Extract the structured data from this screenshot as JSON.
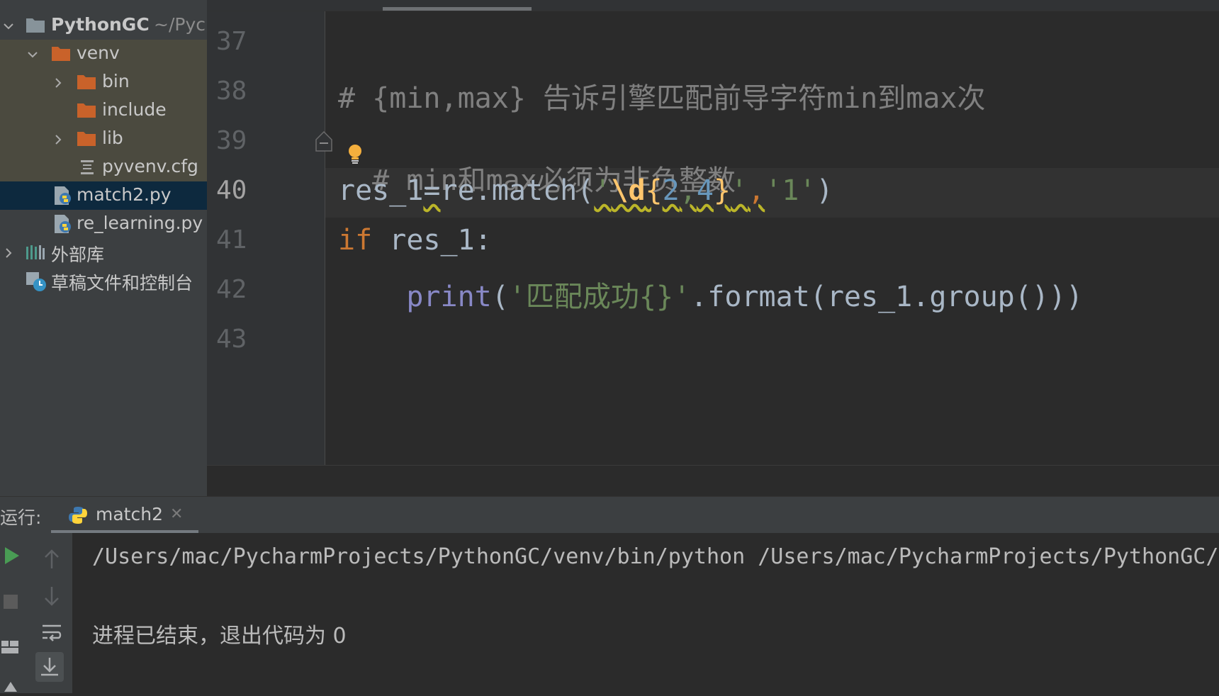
{
  "project": {
    "root_name": "PythonGC",
    "root_path": "~/Pycl",
    "items": [
      {
        "label": "venv",
        "icon": "folder-icon"
      },
      {
        "label": "bin",
        "icon": "folder-icon"
      },
      {
        "label": "include",
        "icon": "folder-icon"
      },
      {
        "label": "lib",
        "icon": "folder-icon"
      },
      {
        "label": "pyvenv.cfg",
        "icon": "config-file-icon"
      },
      {
        "label": "match2.py",
        "icon": "python-file-icon"
      },
      {
        "label": "re_learning.py",
        "icon": "python-file-icon"
      },
      {
        "label": "外部库",
        "icon": "library-icon"
      },
      {
        "label": "草稿文件和控制台",
        "icon": "scratches-icon"
      }
    ]
  },
  "editor": {
    "line_numbers": [
      "37",
      "38",
      "39",
      "40",
      "41",
      "42",
      "43"
    ],
    "current_line": "40",
    "lines": {
      "l38": "# {min,max} 告诉引擎匹配前导字符min到max次",
      "l39_hash": "#",
      "l39_rest": " min和max必须为非负整数",
      "l40_a": "res_1",
      "l40_b": "=",
      "l40_c": "re.match(",
      "l40_q1": "'",
      "l40_d": "\\d",
      "l40_brace_open": "{",
      "l40_n1": "2",
      "l40_comma": ",",
      "l40_n2": "4",
      "l40_brace_close": "}",
      "l40_q2": "'",
      "l40_sep": ",",
      "l40_str2": "'1'",
      "l40_end": ")",
      "l41_kw": "if",
      "l41_rest": " res_1:",
      "l42_indent": "    ",
      "l42_fn": "print",
      "l42_paren": "(",
      "l42_str": "'匹配成功{}'",
      "l42_rest": ".format(res_1.group()))"
    }
  },
  "run": {
    "label": "运行:",
    "tab_label": "match2",
    "console_lines": [
      "/Users/mac/PycharmProjects/PythonGC/venv/bin/python /Users/mac/PycharmProjects/PythonGC/r",
      "进程已结束，退出代码为 0"
    ]
  },
  "colors": {
    "keyword": "#cc7832",
    "string": "#6a8759",
    "number": "#6897bb",
    "builtin": "#8888c6",
    "comment": "#808080",
    "folder": "#c9622a"
  }
}
